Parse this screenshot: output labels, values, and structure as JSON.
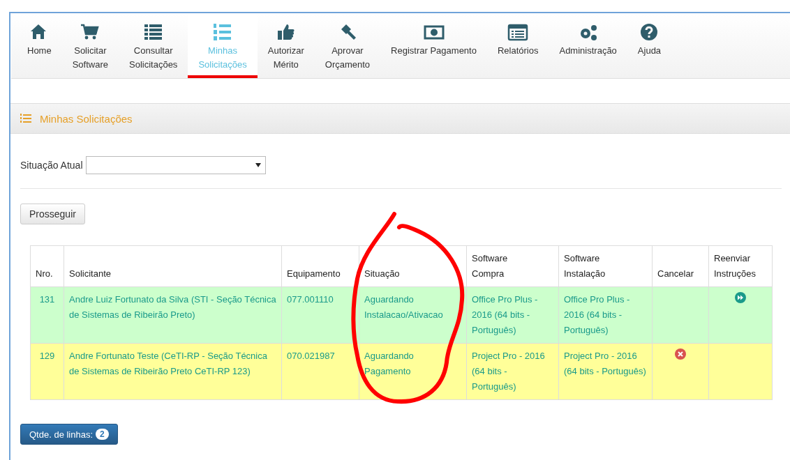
{
  "nav": {
    "items": [
      {
        "label": "Home",
        "selected": false
      },
      {
        "label": "Solicitar\nSoftware",
        "selected": false
      },
      {
        "label": "Consultar\nSolicitações",
        "selected": false
      },
      {
        "label": "Minhas\nSolicitações",
        "selected": true
      },
      {
        "label": "Autorizar\nMérito",
        "selected": false
      },
      {
        "label": "Aprovar\nOrçamento",
        "selected": false
      },
      {
        "label": "Registrar Pagamento",
        "selected": false
      },
      {
        "label": "Relatórios",
        "selected": false
      },
      {
        "label": "Administração",
        "selected": false
      },
      {
        "label": "Ajuda",
        "selected": false
      }
    ]
  },
  "panel": {
    "title": "Minhas Solicitações"
  },
  "filter": {
    "label": "Situação Atual"
  },
  "submit_button": "Prosseguir",
  "table": {
    "columns": [
      "Nro.",
      "Solicitante",
      "Equipamento",
      "Situação",
      "Software\nCompra",
      "Software\nInstalação",
      "Cancelar",
      "Reenviar\nInstruções"
    ],
    "rows": [
      {
        "color": "#ccffcc",
        "cells": [
          "131",
          "Andre Luiz Fortunato da Silva (STI - Seção Técnica de Sistemas de Ribeirão Preto)",
          "077.001110",
          "Aguardando Instalacao/Ativacao",
          "Office Pro Plus - 2016 (64 bits - Português)",
          "Office Pro Plus - 2016 (64 bits - Português)"
        ],
        "cancel": false,
        "resend": true
      },
      {
        "color": "#ffff99",
        "cells": [
          "129",
          "Andre Fortunato Teste (CeTI-RP - Seção Técnica de Sistemas de Ribeirão Preto CeTI-RP 123)",
          "070.021987",
          "Aguardando Pagamento",
          "Project Pro - 2016 (64 bits - Português)",
          "Project Pro - 2016 (64 bits - Português)"
        ],
        "cancel": true,
        "resend": false
      }
    ]
  },
  "footer": {
    "label": "Qtde. de linhas:",
    "count": "2"
  }
}
